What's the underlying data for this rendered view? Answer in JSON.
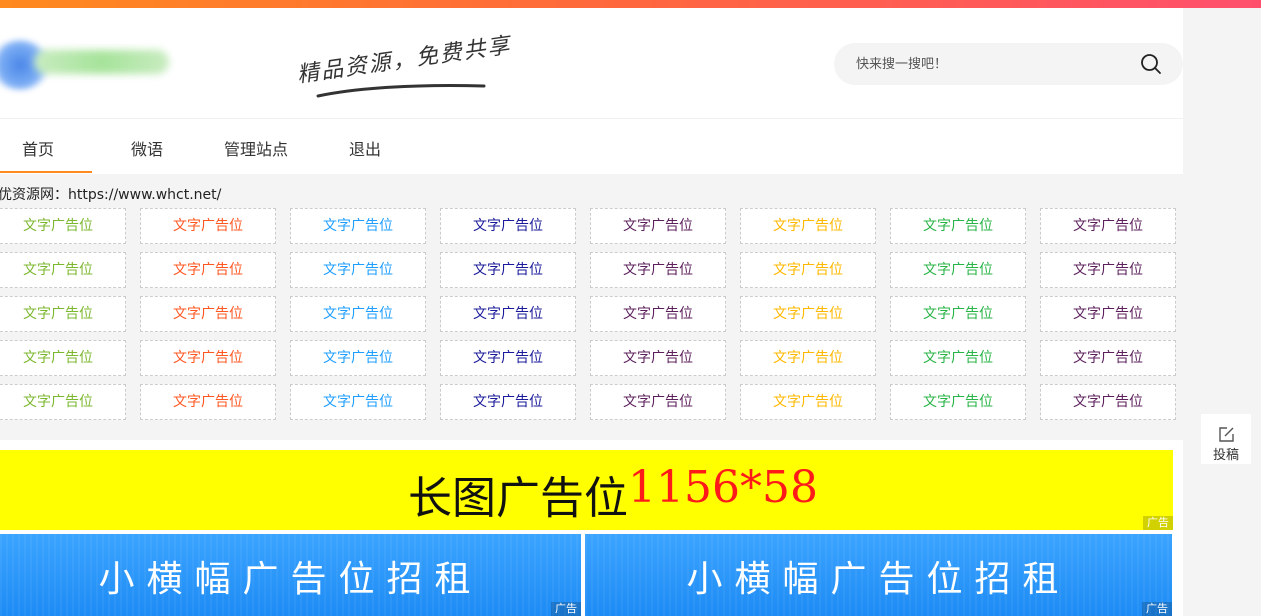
{
  "header": {
    "slogan": "精品资源，免费共享",
    "search_placeholder": "快来搜一搜吧！"
  },
  "nav": {
    "items": [
      {
        "label": "首页"
      },
      {
        "label": "微语"
      },
      {
        "label": "管理站点"
      },
      {
        "label": "退出"
      }
    ]
  },
  "site_url": "优资源网：https://www.whct.net/",
  "text_ads": {
    "label": "文字广告位",
    "column_colors": [
      "#7cb82f",
      "#ff5722",
      "#1e9fff",
      "#1a1a9a",
      "#5c1f5c",
      "#ffb800",
      "#28b446",
      "#5c1f5c"
    ]
  },
  "banner_long": {
    "title": "长图广告位",
    "size": "1156*58",
    "tag": "广告"
  },
  "banner_small": [
    {
      "title": "小横幅广告位招租",
      "tag": "广告"
    },
    {
      "title": "小横幅广告位招租",
      "tag": "广告"
    }
  ],
  "side": {
    "submit_label": "投稿"
  },
  "colors": {
    "accent": "#ff8a1f",
    "banner_yellow": "#ffff00",
    "banner_blue": "#1d8bf5"
  }
}
